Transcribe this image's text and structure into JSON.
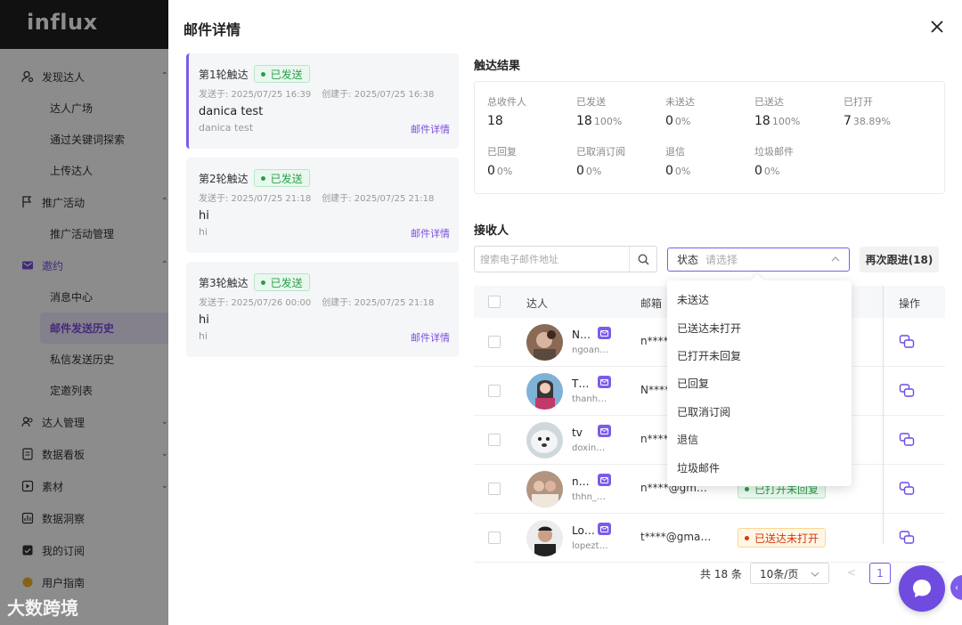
{
  "sidebar": {
    "logo": "influx",
    "groups": [
      {
        "label": "发现达人",
        "icon": "user-search-icon",
        "expanded": true,
        "items": [
          "达人广场",
          "通过关键词探索",
          "上传达人"
        ]
      },
      {
        "label": "推广活动",
        "icon": "flag-icon",
        "expanded": true,
        "items": [
          "推广活动管理"
        ]
      },
      {
        "label": "邀约",
        "icon": "mail-icon",
        "expanded": true,
        "items": [
          "消息中心",
          "邮件发送历史",
          "私信发送历史",
          "定邀列表"
        ]
      },
      {
        "label": "达人管理",
        "icon": "users-icon"
      },
      {
        "label": "数据看板",
        "icon": "doc-icon"
      },
      {
        "label": "素材",
        "icon": "media-icon"
      },
      {
        "label": "数据洞察",
        "icon": "insight-icon"
      },
      {
        "label": "我的订阅",
        "icon": "subscription-icon"
      },
      {
        "label": "用户指南",
        "icon": "guide-icon"
      }
    ],
    "active_item": "邮件发送历史",
    "watermark": "大数跨境"
  },
  "drawer": {
    "title": "邮件详情",
    "rounds": [
      {
        "title": "第1轮触达",
        "status": "已发送",
        "sent_at": "发送于: 2025/07/25 16:39",
        "created_at": "创建于: 2025/07/25 16:38",
        "subject": "danica test",
        "body": "danica test",
        "link": "邮件详情"
      },
      {
        "title": "第2轮触达",
        "status": "已发送",
        "sent_at": "发送于: 2025/07/25 21:18",
        "created_at": "创建于: 2025/07/25 21:18",
        "subject": "hi",
        "body": "hi",
        "link": "邮件详情"
      },
      {
        "title": "第3轮触达",
        "status": "已发送",
        "sent_at": "发送于: 2025/07/26 00:00",
        "created_at": "创建于: 2025/07/25 21:18",
        "subject": "hi",
        "body": "hi",
        "link": "邮件详情"
      }
    ],
    "results": {
      "title": "触达结果",
      "stats": [
        {
          "label": "总收件人",
          "value": "18",
          "pct": ""
        },
        {
          "label": "已发送",
          "value": "18",
          "pct": "100%"
        },
        {
          "label": "未送达",
          "value": "0",
          "pct": "0%"
        },
        {
          "label": "已送达",
          "value": "18",
          "pct": "100%"
        },
        {
          "label": "已打开",
          "value": "7",
          "pct": "38.89%"
        },
        {
          "label": "已回复",
          "value": "0",
          "pct": "0%"
        },
        {
          "label": "已取消订阅",
          "value": "0",
          "pct": "0%"
        },
        {
          "label": "退信",
          "value": "0",
          "pct": "0%"
        },
        {
          "label": "垃圾邮件",
          "value": "0",
          "pct": "0%"
        }
      ]
    },
    "recipients": {
      "title": "接收人",
      "search_placeholder": "搜索电子邮件地址",
      "status_label": "状态",
      "status_placeholder": "请选择",
      "followup_button": "再次跟进(18)",
      "columns": {
        "influencer": "达人",
        "email": "邮箱",
        "action": "操作"
      },
      "rows": [
        {
          "name": "N…",
          "handle": "ngoan…",
          "email": "n****",
          "status": "",
          "status_color": ""
        },
        {
          "name": "T…",
          "handle": "thanh…",
          "email": "N****",
          "status": "",
          "status_color": ""
        },
        {
          "name": "tv",
          "handle": "doxin…",
          "email": "n****",
          "status": "",
          "status_color": ""
        },
        {
          "name": "n…",
          "handle": "thhn_…",
          "email": "n****@gm…",
          "status": "已打开未回复",
          "status_color": "green"
        },
        {
          "name": "Lo…",
          "handle": "lopezt…",
          "email": "t****@gma…",
          "status": "已送达未打开",
          "status_color": "orange"
        }
      ],
      "status_options": [
        "未送达",
        "已送达未打开",
        "已打开未回复",
        "已回复",
        "已取消订阅",
        "退信",
        "垃圾邮件"
      ]
    },
    "pagination": {
      "total": "共 18 条",
      "page_size": "10条/页",
      "prev": "<",
      "current_page": "1"
    }
  },
  "colors": {
    "accent": "#7c5ce8",
    "success": "#2a9d4b",
    "warning": "#d4380d"
  }
}
